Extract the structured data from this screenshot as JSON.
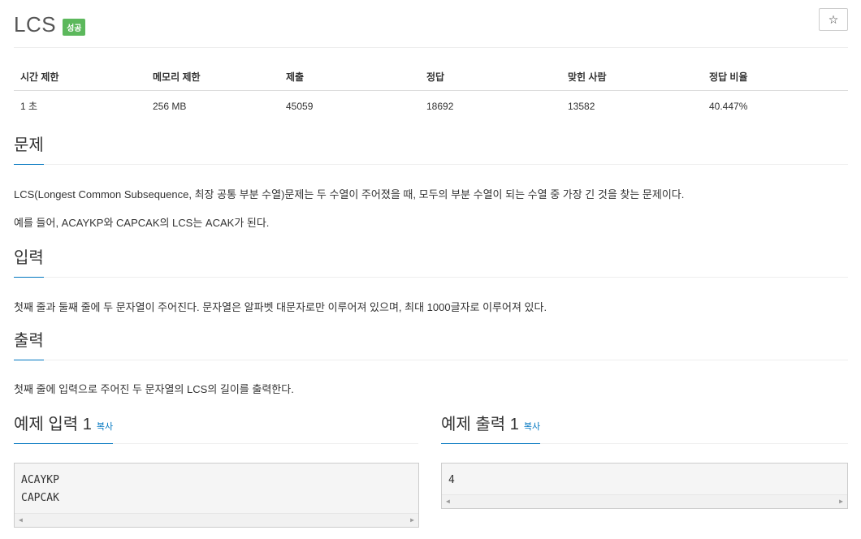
{
  "header": {
    "title": "LCS",
    "badge": "성공",
    "star": "☆"
  },
  "info": {
    "headers": [
      "시간 제한",
      "메모리 제한",
      "제출",
      "정답",
      "맞힌 사람",
      "정답 비율"
    ],
    "values": [
      "1 초",
      "256 MB",
      "45059",
      "18692",
      "13582",
      "40.447%"
    ]
  },
  "problem": {
    "title": "문제",
    "p1": "LCS(Longest Common Subsequence, 최장 공통 부분 수열)문제는 두 수열이 주어졌을 때, 모두의 부분 수열이 되는 수열 중 가장 긴 것을 찾는 문제이다.",
    "p2": "예를 들어, ACAYKP와 CAPCAK의 LCS는 ACAK가 된다."
  },
  "input": {
    "title": "입력",
    "p1": "첫째 줄과 둘째 줄에 두 문자열이 주어진다. 문자열은 알파벳 대문자로만 이루어져 있으며, 최대 1000글자로 이루어져 있다."
  },
  "output": {
    "title": "출력",
    "p1": "첫째 줄에 입력으로 주어진 두 문자열의 LCS의 길이를 출력한다."
  },
  "sample_input": {
    "title": "예제 입력 1",
    "copy": "복사",
    "lines": [
      "ACAYKP",
      "CAPCAK"
    ]
  },
  "sample_output": {
    "title": "예제 출력 1",
    "copy": "복사",
    "lines": [
      "4"
    ]
  }
}
